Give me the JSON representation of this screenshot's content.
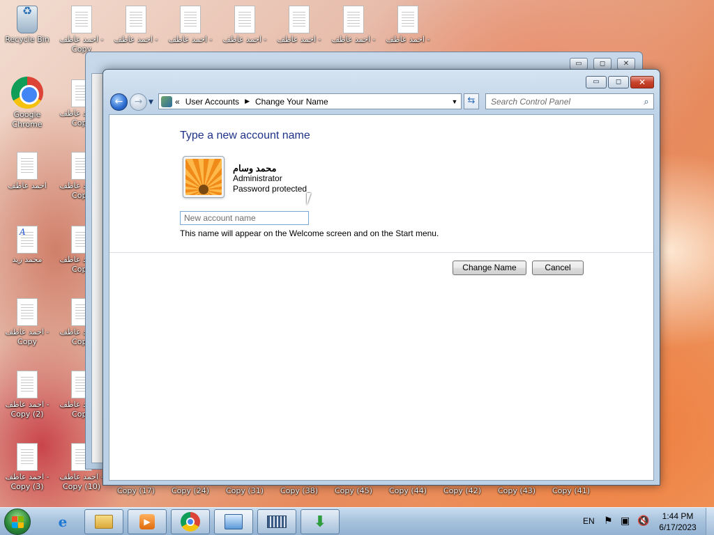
{
  "desktop": {
    "icons": [
      {
        "label": "Recycle Bin",
        "icon": "recycle-bin-icon"
      },
      {
        "label": "Google Chrome",
        "icon": "chrome-icon"
      },
      {
        "label": "احمد عاطف",
        "icon": "text-document-icon"
      },
      {
        "label": "محمد زيد",
        "icon": "wordpad-document-icon"
      },
      {
        "label": "احمد عاطف - Copy",
        "icon": "text-document-icon"
      },
      {
        "label": "احمد عاطف - Copy (2)",
        "icon": "text-document-icon"
      },
      {
        "label": "احمد عاطف - Copy (3)",
        "icon": "text-document-icon"
      },
      {
        "label": "احمد عاطف - Copy",
        "icon": "text-document-icon"
      },
      {
        "label": "احمد عاطف - Copy",
        "icon": "text-document-icon"
      },
      {
        "label": "احمد عاطف - Copy",
        "icon": "text-document-icon"
      },
      {
        "label": "احمد عاطف - Copy",
        "icon": "text-document-icon"
      },
      {
        "label": "احمد عاطف - Copy",
        "icon": "text-document-icon"
      },
      {
        "label": "احمد عاطف - Copy",
        "icon": "text-document-icon"
      },
      {
        "label": "احمد عاطف - Copy (10)",
        "icon": "text-document-icon"
      },
      {
        "label": "احمد عاطف -",
        "icon": "text-document-icon"
      },
      {
        "label": "احمد عاطف -",
        "icon": "text-document-icon"
      },
      {
        "label": "احمد عاطف -",
        "icon": "text-document-icon"
      },
      {
        "label": "احمد عاطف -",
        "icon": "text-document-icon"
      },
      {
        "label": "احمد عاطف -",
        "icon": "text-document-icon"
      },
      {
        "label": "احمد عاطف -",
        "icon": "text-document-icon"
      }
    ],
    "bottom_row_labels": [
      "Copy (17)",
      "Copy (24)",
      "Copy (31)",
      "Copy (38)",
      "Copy (45)",
      "Copy (44)",
      "Copy (42)",
      "Copy (43)",
      "Copy (41)"
    ]
  },
  "window": {
    "breadcrumb": {
      "overflow": "«",
      "items": [
        "User Accounts",
        "Change Your Name"
      ]
    },
    "search_placeholder": "Search Control Panel",
    "controls": {
      "minimize": "▭",
      "maximize": "◻",
      "close": "✕"
    }
  },
  "page": {
    "heading": "Type a new account name",
    "user": {
      "name": "محمد وسام",
      "role": "Administrator",
      "status": "Password protected"
    },
    "input_placeholder": "New account name",
    "hint": "This name will appear on the Welcome screen and on the Start menu.",
    "buttons": {
      "change": "Change Name",
      "cancel": "Cancel"
    }
  },
  "taskbar": {
    "items": [
      {
        "name": "internet-explorer",
        "icon": "ie-icon"
      },
      {
        "name": "file-explorer",
        "icon": "folder-icon"
      },
      {
        "name": "media-player",
        "icon": "media-player-icon"
      },
      {
        "name": "google-chrome",
        "icon": "chrome-icon"
      },
      {
        "name": "control-panel",
        "icon": "control-panel-icon"
      },
      {
        "name": "on-screen-keyboard",
        "icon": "keyboard-icon"
      },
      {
        "name": "download-manager",
        "icon": "download-icon"
      }
    ],
    "language": "EN",
    "time": "1:44 PM",
    "date": "6/17/2023"
  }
}
